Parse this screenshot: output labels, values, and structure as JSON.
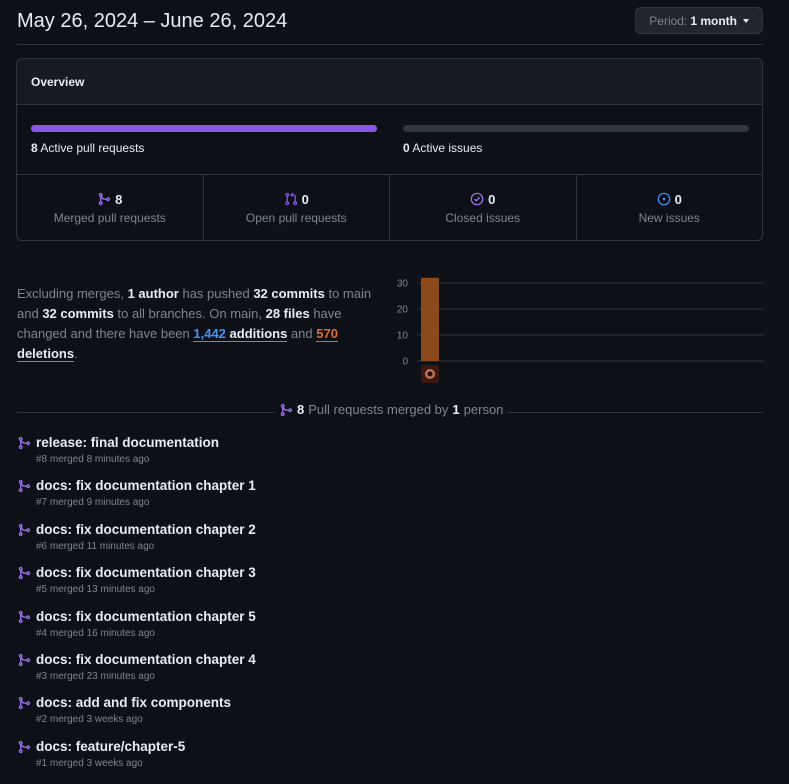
{
  "header": {
    "date_range": "May 26, 2024 – June 26, 2024",
    "period_label": "Period:",
    "period_value": "1 month"
  },
  "overview": {
    "title": "Overview",
    "active_prs_count": "8",
    "active_prs_label": "Active pull requests",
    "active_prs_fill": 1.0,
    "active_issues_count": "0",
    "active_issues_label": "Active issues",
    "active_issues_fill": 0.0,
    "stats": [
      {
        "value": "8",
        "label": "Merged pull requests",
        "icon": "merged-icon"
      },
      {
        "value": "0",
        "label": "Open pull requests",
        "icon": "pull-request-icon"
      },
      {
        "value": "0",
        "label": "Closed issues",
        "icon": "issue-closed-icon"
      },
      {
        "value": "0",
        "label": "New issues",
        "icon": "issue-opened-icon"
      }
    ]
  },
  "summary": {
    "t1": "Excluding merges, ",
    "authors": "1 author",
    "t2": " has pushed ",
    "commits_main": "32 commits",
    "t3": " to main and ",
    "commits_all": "32 commits",
    "t4": " to all branches. On main, ",
    "files": "28 files",
    "t5": " have changed and there have been ",
    "additions_num": "1,442",
    "additions_word": "additions",
    "t6": " and ",
    "deletions_num": "570",
    "deletions_word": "deletions",
    "t7": "."
  },
  "chart_data": {
    "type": "bar",
    "categories": [
      ""
    ],
    "values": [
      32
    ],
    "ylim": [
      0,
      30
    ],
    "yticks": [
      "30",
      "20",
      "10",
      "0"
    ],
    "color": "#8b4a1b"
  },
  "merged_divider": {
    "count": "8",
    "t1": "Pull requests merged by",
    "people": "1",
    "t2": "person"
  },
  "pull_requests": [
    {
      "title": "release: final documentation",
      "meta": "#8 merged 8 minutes ago"
    },
    {
      "title": "docs: fix documentation chapter 1",
      "meta": "#7 merged 9 minutes ago"
    },
    {
      "title": "docs: fix documentation chapter 2",
      "meta": "#6 merged 11 minutes ago"
    },
    {
      "title": "docs: fix documentation chapter 3",
      "meta": "#5 merged 13 minutes ago"
    },
    {
      "title": "docs: fix documentation chapter 5",
      "meta": "#4 merged 16 minutes ago"
    },
    {
      "title": "docs: fix documentation chapter 4",
      "meta": "#3 merged 23 minutes ago"
    },
    {
      "title": "docs: add and fix components",
      "meta": "#2 merged 3 weeks ago"
    },
    {
      "title": "docs: feature/chapter-5",
      "meta": "#1 merged 3 weeks ago"
    }
  ],
  "colors": {
    "background": "#0d1117",
    "border": "#30363d",
    "purple": "#8957e5",
    "blue": "#4493f8",
    "orange": "#db6d28"
  }
}
